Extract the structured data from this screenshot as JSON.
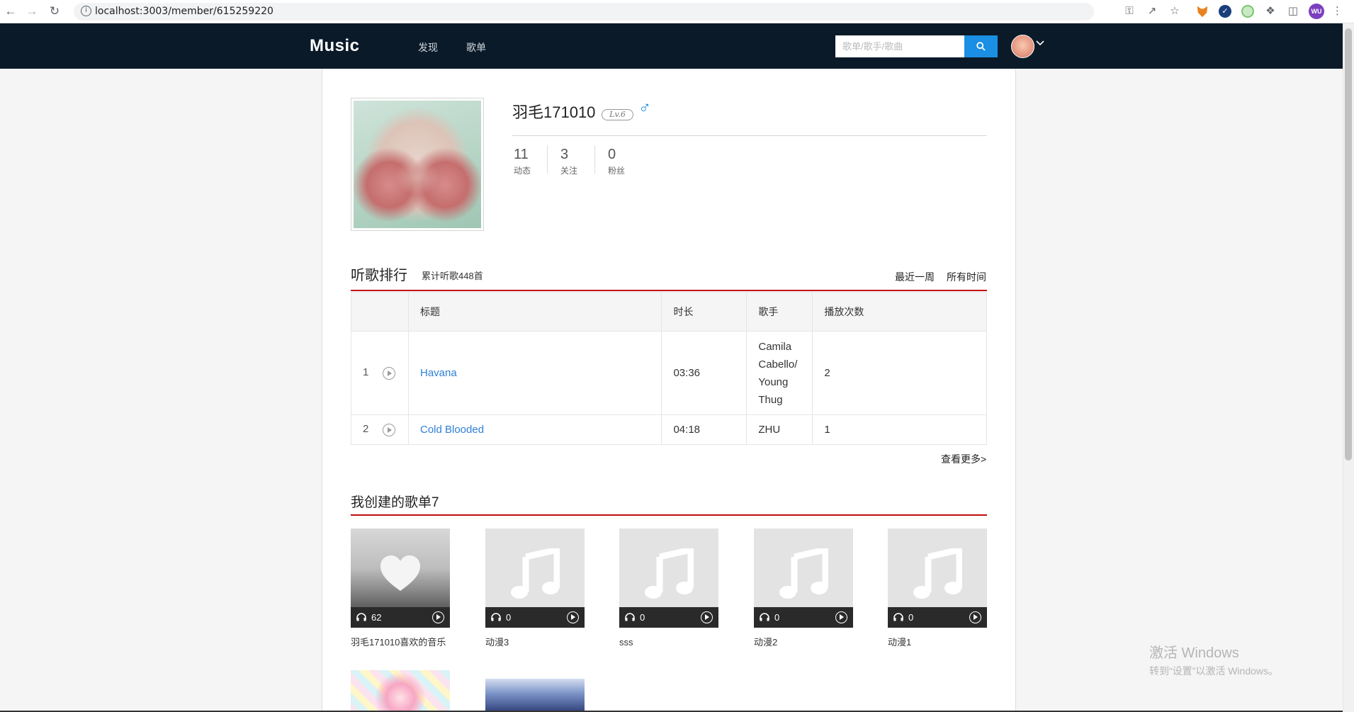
{
  "browser": {
    "url": "localhost:3003/member/615259220",
    "profile_initials": "WU"
  },
  "nav": {
    "logo": "Music",
    "menu": [
      "发现",
      "歌单"
    ],
    "search_placeholder": "歌单/歌手/歌曲"
  },
  "profile": {
    "username": "羽毛171010",
    "level": "Lv.6",
    "gender_icon": "male-icon",
    "stats": [
      {
        "num": "11",
        "label": "动态"
      },
      {
        "num": "3",
        "label": "关注"
      },
      {
        "num": "0",
        "label": "粉丝"
      }
    ]
  },
  "ranking": {
    "title": "听歌排行",
    "subtitle": "累计听歌448首",
    "range_week": "最近一周",
    "range_all": "所有时间",
    "columns": [
      "标题",
      "时长",
      "歌手",
      "播放次数"
    ],
    "rows": [
      {
        "idx": "1",
        "title": "Havana",
        "duration": "03:36",
        "artist": "Camila Cabello/ Young Thug",
        "plays": "2"
      },
      {
        "idx": "2",
        "title": "Cold Blooded",
        "duration": "04:18",
        "artist": "ZHU",
        "plays": "1"
      }
    ],
    "more": "查看更多>"
  },
  "playlists": {
    "title": "我创建的歌单7",
    "items": [
      {
        "name": "羽毛171010喜欢的音乐",
        "count": "62"
      },
      {
        "name": "动漫3",
        "count": "0"
      },
      {
        "name": "sss",
        "count": "0"
      },
      {
        "name": "动漫2",
        "count": "0"
      },
      {
        "name": "动漫1",
        "count": "0"
      }
    ]
  },
  "watermark": {
    "line1": "激活 Windows",
    "line2": "转到“设置”以激活 Windows。"
  },
  "colors": {
    "nav_bg": "#0b1a29",
    "accent_blue": "#1a8fe3",
    "accent_red": "#c20c0c",
    "link_blue": "#2d7fd6"
  }
}
